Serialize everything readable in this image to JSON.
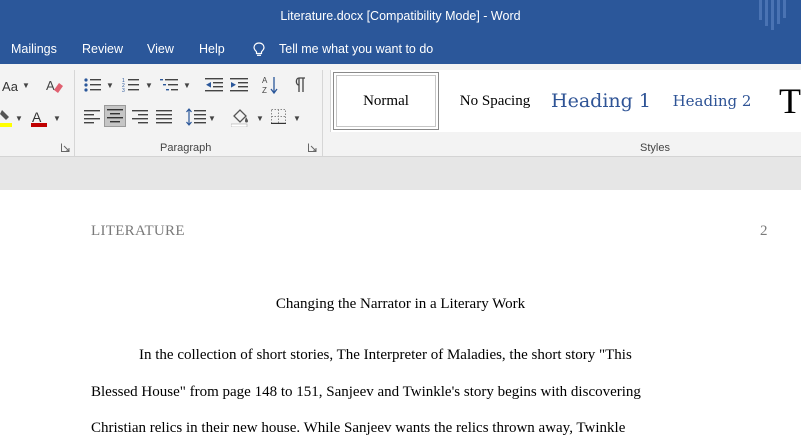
{
  "window": {
    "title": "Literature.docx [Compatibility Mode]  -  Word"
  },
  "menu": {
    "items": [
      "Mailings",
      "Review",
      "View",
      "Help"
    ],
    "tell_me": "Tell me what you want to do"
  },
  "ribbon": {
    "font_group": {
      "font_size_label": "Aa"
    },
    "paragraph_group": {
      "label": "Paragraph"
    },
    "styles_group": {
      "label": "Styles",
      "styles": [
        "Normal",
        "No Spacing",
        "Heading 1",
        "Heading 2",
        "T"
      ],
      "selected": "Normal"
    }
  },
  "colors": {
    "titlebar": "#2b579a",
    "heading_blue": "#2f5496",
    "font_color_underline": "#c00000",
    "highlight_underline": "#ffff00"
  },
  "document": {
    "running_head": "LITERATURE",
    "page_number": "2",
    "title": "Changing the Narrator in a Literary Work",
    "paragraph_lines": [
      "In the collection of short stories, The Interpreter of Maladies, the short story \"This",
      "Blessed House\" from page 148 to 151, Sanjeev and Twinkle's story begins with discovering",
      "Christian relics in their new house. While Sanjeev wants the relics thrown away, Twinkle"
    ]
  }
}
